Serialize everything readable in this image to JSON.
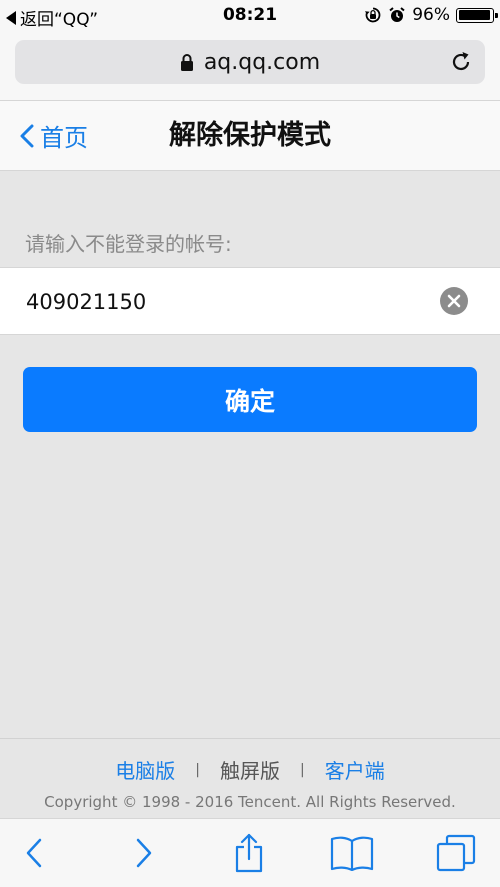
{
  "status_bar": {
    "back_label": "返回“QQ”",
    "time": "08:21",
    "battery": "96%",
    "battery_level": 0.96
  },
  "address_bar": {
    "url": "aq.qq.com"
  },
  "nav": {
    "back_label": "首页",
    "title": "解除保护模式"
  },
  "form": {
    "prompt": "请输入不能登录的帐号:",
    "account_value": "409021150",
    "confirm_label": "确定"
  },
  "footer": {
    "links": [
      "电脑版",
      "触屏版",
      "客户端"
    ],
    "separator": "|",
    "copyright": "Copyright © 1998 - 2016 Tencent. All Rights Reserved."
  },
  "toolbar": {
    "icons": [
      "back-arrow-icon",
      "forward-arrow-icon",
      "share-icon",
      "bookmarks-icon",
      "tabs-icon"
    ]
  },
  "colors": {
    "accent": "#0a7bff",
    "link": "#1a7fe6",
    "background": "#e6e6e6"
  }
}
